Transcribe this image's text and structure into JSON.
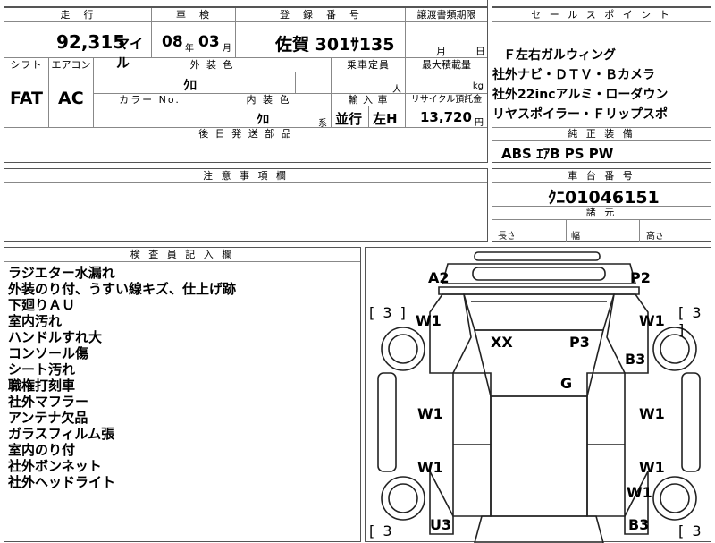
{
  "header": {
    "mileage_label": "走　行",
    "inspection_label": "車　検",
    "registration_label": "登　録　番　号",
    "transfer_label": "譲渡書類期限",
    "mileage_value": "92,315",
    "mileage_unit": "マイル",
    "inspection_year": "08",
    "year_unit": "年",
    "inspection_month": "03",
    "month_unit": "月",
    "registration_value": "佐賀 301ｻ135",
    "transfer_month": "月",
    "transfer_day": "日"
  },
  "row2": {
    "shift_label": "シフト",
    "ac_label": "エアコン",
    "exterior_color_label": "外 装 色",
    "capacity_label": "乗車定員",
    "max_load_label": "最大積載量",
    "shift_value": "FAT",
    "ac_value": "AC",
    "exterior_color_value": "ｸﾛ",
    "capacity_unit": "人",
    "load_unit": "kg",
    "color_no_label": "カラー No.",
    "interior_color_label": "内 装 色",
    "import_label": "輸 入 車",
    "recycle_label": "リサイクル預託金",
    "interior_color_value": "ｸﾛ",
    "interior_suffix": "系",
    "import_type": "並行",
    "steering": "左H",
    "recycle_value": "13,720",
    "recycle_unit": "円",
    "parts_label": "後 日 発 送 部 品"
  },
  "caution": {
    "label": "注 意 事 項 欄"
  },
  "sales_points": {
    "label": "セ ー ル ス ポ イ ン ト",
    "items": [
      "Ｆ左右ガルウィング",
      "社外ナビ・ＤＴＶ・Ｂカメラ",
      "社外22incアルミ・ローダウン",
      "リヤスポイラー・Ｆリップスポ"
    ]
  },
  "equipment": {
    "label": "純 正 装 備",
    "value": "ABS ｴｱB PS PW"
  },
  "chassis": {
    "label": "車 台 番 号",
    "value": "ｸﾆ01046151"
  },
  "dimensions": {
    "label": "諸 元",
    "length_label": "長さ",
    "width_label": "幅",
    "height_label": "高さ"
  },
  "inspector": {
    "label": "検 査 員 記 入 欄",
    "notes": [
      "ラジエター水漏れ",
      "外装のり付、うすい線キズ、仕上げ跡",
      "下廻りＡＵ",
      "室内汚れ",
      "ハンドルすれ大",
      "コンソール傷",
      "シート汚れ",
      "職権打刻車",
      "社外マフラー",
      "アンテナ欠品",
      "ガラスフィルム張",
      "室内のり付",
      "社外ボンネット",
      "社外ヘッドライト"
    ]
  },
  "diagram": {
    "marks": {
      "a2": "A2",
      "p2": "P2",
      "bracket_tl": "[ 3 ]",
      "bracket_tr": "[ 3 ]",
      "bracket_bl": "[ 3",
      "bracket_br": "[ 3",
      "w1_fl": "W1",
      "w1_fr": "W1",
      "xx": "XX",
      "p3": "P3",
      "b3_r": "B3",
      "g": "G",
      "w1_ml1": "W1",
      "w1_mr1": "W1",
      "w1_ml2": "W1",
      "w1_mr2": "W1",
      "w1_rr": "W1",
      "u3": "U3",
      "b3_rr": "B3"
    }
  }
}
